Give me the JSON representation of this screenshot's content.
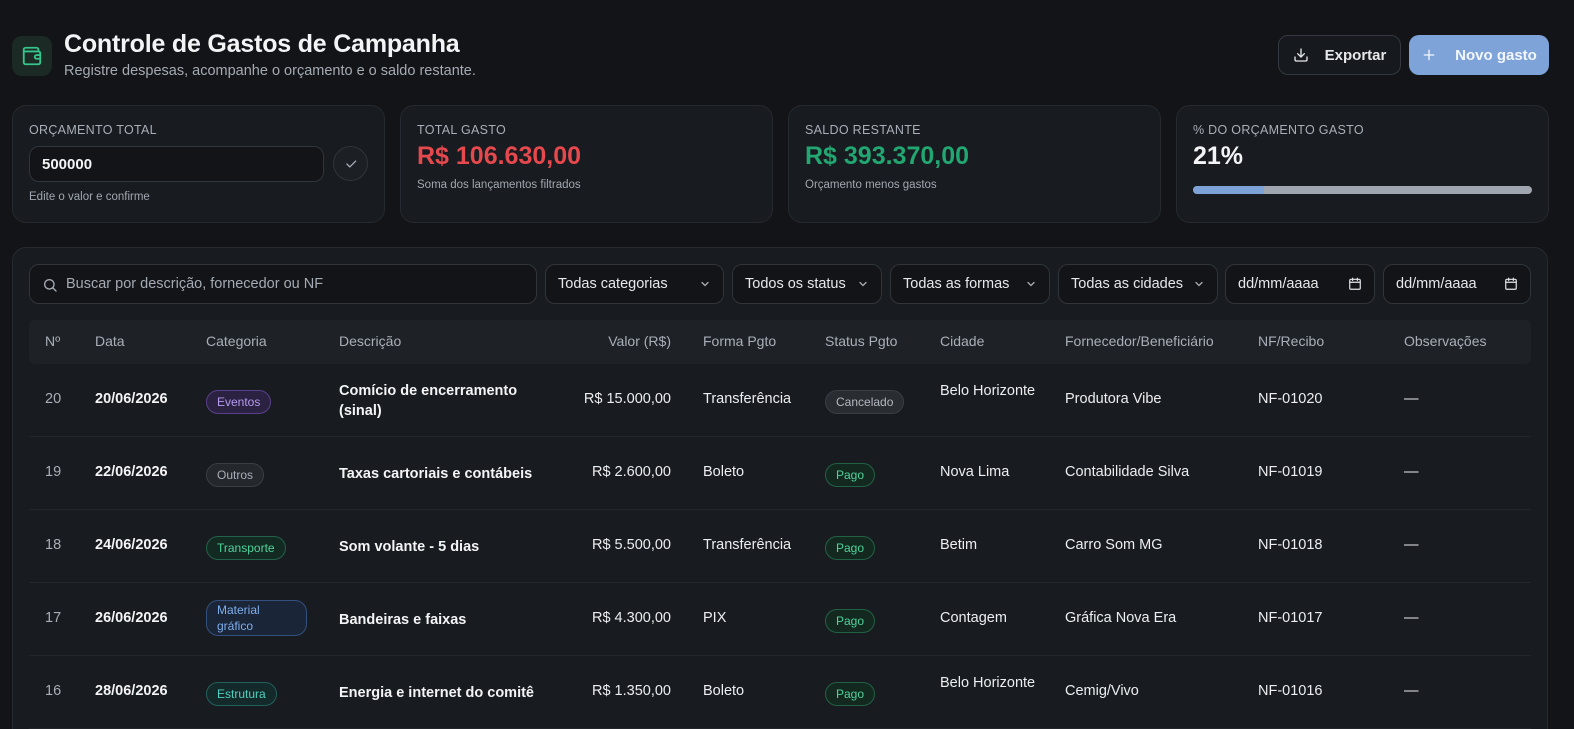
{
  "header": {
    "title": "Controle de Gastos de Campanha",
    "subtitle": "Registre despesas, acompanhe o orçamento e o saldo restante.",
    "export_label": "Exportar",
    "new_label": "Novo gasto"
  },
  "cards": {
    "budget": {
      "label": "ORÇAMENTO TOTAL",
      "value": "500000",
      "hint": "Edite o valor e confirme"
    },
    "spent": {
      "label": "TOTAL GASTO",
      "value": "R$ 106.630,00",
      "hint": "Soma dos lançamentos filtrados",
      "color": "#e5484d"
    },
    "balance": {
      "label": "SALDO RESTANTE",
      "value": "R$ 393.370,00",
      "hint": "Orçamento menos gastos",
      "color": "#22a672"
    },
    "percent": {
      "label": "% DO ORÇAMENTO GASTO",
      "value": "21%",
      "progress": 0.21
    }
  },
  "filters": {
    "search_placeholder": "Buscar por descrição, fornecedor ou NF",
    "category": "Todas categorias",
    "status": "Todos os status",
    "payment": "Todas as formas",
    "city": "Todas as cidades",
    "date_from": "dd/mm/aaaa",
    "date_to": "dd/mm/aaaa"
  },
  "table": {
    "headers": {
      "num": "Nº",
      "date": "Data",
      "category": "Categoria",
      "description": "Descrição",
      "value": "Valor (R$)",
      "payment": "Forma Pgto",
      "status": "Status Pgto",
      "city": "Cidade",
      "supplier": "Fornecedor/Beneficiário",
      "nf": "NF/Recibo",
      "notes": "Observações"
    },
    "rows": [
      {
        "num": "20",
        "date": "20/06/2026",
        "category": "Eventos",
        "description": "Comício de encerramento (sinal)",
        "value": "R$ 15.000,00",
        "payment": "Transferência",
        "status": "Cancelado",
        "city": "Belo Horizonte",
        "supplier": "Produtora Vibe",
        "nf": "NF-01020",
        "notes": "—"
      },
      {
        "num": "19",
        "date": "22/06/2026",
        "category": "Outros",
        "description": "Taxas cartoriais e contábeis",
        "value": "R$ 2.600,00",
        "payment": "Boleto",
        "status": "Pago",
        "city": "Nova Lima",
        "supplier": "Contabilidade Silva",
        "nf": "NF-01019",
        "notes": "—"
      },
      {
        "num": "18",
        "date": "24/06/2026",
        "category": "Transporte",
        "description": "Som volante - 5 dias",
        "value": "R$ 5.500,00",
        "payment": "Transferência",
        "status": "Pago",
        "city": "Betim",
        "supplier": "Carro Som MG",
        "nf": "NF-01018",
        "notes": "—"
      },
      {
        "num": "17",
        "date": "26/06/2026",
        "category": "Material gráfico",
        "description": "Bandeiras e faixas",
        "value": "R$ 4.300,00",
        "payment": "PIX",
        "status": "Pago",
        "city": "Contagem",
        "supplier": "Gráfica Nova Era",
        "nf": "NF-01017",
        "notes": "—"
      },
      {
        "num": "16",
        "date": "28/06/2026",
        "category": "Estrutura",
        "description": "Energia e internet do comitê",
        "value": "R$ 1.350,00",
        "payment": "Boleto",
        "status": "Pago",
        "city": "Belo Horizonte",
        "supplier": "Cemig/Vivo",
        "nf": "NF-01016",
        "notes": "—"
      }
    ]
  }
}
